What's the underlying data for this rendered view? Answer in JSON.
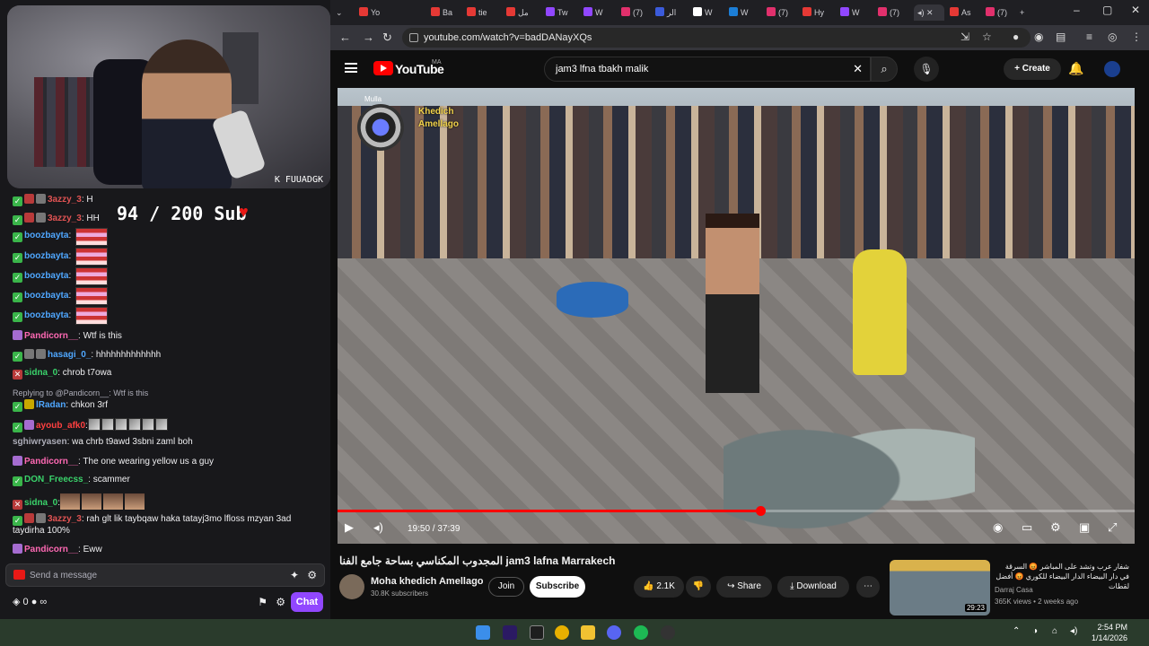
{
  "stream": {
    "cam_tag": "K FUUADGK",
    "sub_goal": "94 / 200 Sub",
    "heart": "♥"
  },
  "chat": {
    "messages": [
      {
        "user": "3azzy_3",
        "text": ": H",
        "color": "#e05353"
      },
      {
        "user": "3azzy_3",
        "text": ": HH",
        "color": "#e05353"
      },
      {
        "user": "boozbayta",
        "text": ":",
        "color": "#4fa7ff"
      },
      {
        "user": "boozbayta",
        "text": ":",
        "color": "#4fa7ff"
      },
      {
        "user": "boozbayta",
        "text": ":",
        "color": "#4fa7ff"
      },
      {
        "user": "boozbayta",
        "text": ":",
        "color": "#4fa7ff"
      },
      {
        "user": "boozbayta",
        "text": ":",
        "color": "#4fa7ff"
      },
      {
        "user": "Pandicorn__",
        "text": ": Wtf is this",
        "color": "#ff69b4"
      },
      {
        "user": "hasagi_0_",
        "text": ": hhhhhhhhhhhhh",
        "color": "#4fa7ff"
      },
      {
        "user": "sidna_0",
        "text": ": chrob t7owa",
        "color": "#3ad36b"
      },
      {
        "reply": "Replying to @Pandicorn__: Wtf is this"
      },
      {
        "user": "lRadan",
        "text": ": chkon 3rf",
        "color": "#4fa7ff"
      },
      {
        "user": "ayoub_afk0",
        "text": ":",
        "color": "#ff4040"
      },
      {
        "user": "sghiwryasen",
        "text": ": wa chrb t9awd 3sbni zaml boh",
        "color": "#adadb8"
      },
      {
        "user": "Pandicorn__",
        "text": ": The one wearing yellow us a guy",
        "color": "#ff69b4"
      },
      {
        "user": "DON_Freecss_",
        "text": ": scammer",
        "color": "#3ad36b"
      },
      {
        "user": "sidna_0",
        "text": ":",
        "color": "#3ad36b"
      },
      {
        "user": "3azzy_3",
        "text": ": rah glt lik taybqaw haka tatayj3mo lfloss mzyan 3ad taydirha 100%",
        "color": "#e05353"
      },
      {
        "user": "Pandicorn__",
        "text": ": Eww",
        "color": "#ff69b4"
      }
    ],
    "input_placeholder": "Send a message",
    "points": "0",
    "chat_button": "Chat"
  },
  "browser": {
    "url": "youtube.com/watch?v=badDANayXQs",
    "tabs": [
      "Yo",
      "Ba",
      "tie",
      "مل",
      "Tw",
      "W",
      "(7)",
      "الر",
      "W",
      "W",
      "(7)",
      "Hy",
      "W",
      "(7)",
      "As",
      "(7)"
    ]
  },
  "youtube": {
    "brand": "YouTube",
    "country": "MA",
    "search_value": "jam3 lfna tbakh malik",
    "create_label": "Create",
    "overlay_top": "Mulla",
    "overlay_name_1": "Khedich",
    "overlay_name_2": "Amellago",
    "time": "19:50 / 37:39",
    "progress_fraction": 0.53,
    "video_title": "المجدوب المكناسي بساحة جامع الفنا jam3 lafna Marrakech",
    "channel": "Moha khedich Amellago",
    "subscribers": "30.8K subscribers",
    "join": "Join",
    "subscribe": "Subscribe",
    "likes": "2.1K",
    "share": "Share",
    "download": "Download",
    "suggestion": {
      "title": "شفار عرب وتشد على المباشر 😡 السرقة في دار البيضاء الدار البيضاء للكوري 😡 أفضل لقطات",
      "channel": "Darraj Casa",
      "views": "365K views • 2 weeks ago",
      "duration": "29:23"
    }
  },
  "taskbar": {
    "time": "2:54 PM",
    "date": "1/14/2026"
  }
}
